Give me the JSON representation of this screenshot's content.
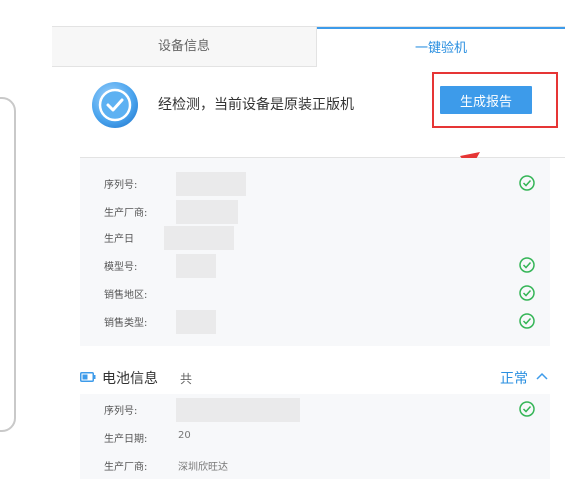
{
  "tabs": {
    "device_info": "设备信息",
    "one_click_check": "一键验机"
  },
  "result": {
    "icon": "check-circle-icon",
    "message": "经检测，当前设备是原装正版机",
    "report_button": "生成报告"
  },
  "device_rows": [
    {
      "label": "序列号:",
      "value": "",
      "verified": true
    },
    {
      "label": "生产厂商:",
      "value": "",
      "verified": false
    },
    {
      "label": "生产日",
      "value": "",
      "verified": false
    },
    {
      "label": "模型号:",
      "value": "",
      "verified": true
    },
    {
      "label": "销售地区:",
      "value": "",
      "verified": true
    },
    {
      "label": "销售类型:",
      "value": "",
      "verified": true
    }
  ],
  "battery": {
    "title": "电池信息",
    "extra": "共",
    "status": "正常",
    "rows": [
      {
        "label": "序列号:",
        "value": "",
        "verified": true
      },
      {
        "label": "生产日期:",
        "value": "20",
        "verified": false
      },
      {
        "label": "生产厂商:",
        "value": "深圳欣旺达",
        "verified": false
      }
    ]
  },
  "colors": {
    "accent": "#3d9bea",
    "success": "#34b556",
    "annotation_red": "#e63535"
  }
}
